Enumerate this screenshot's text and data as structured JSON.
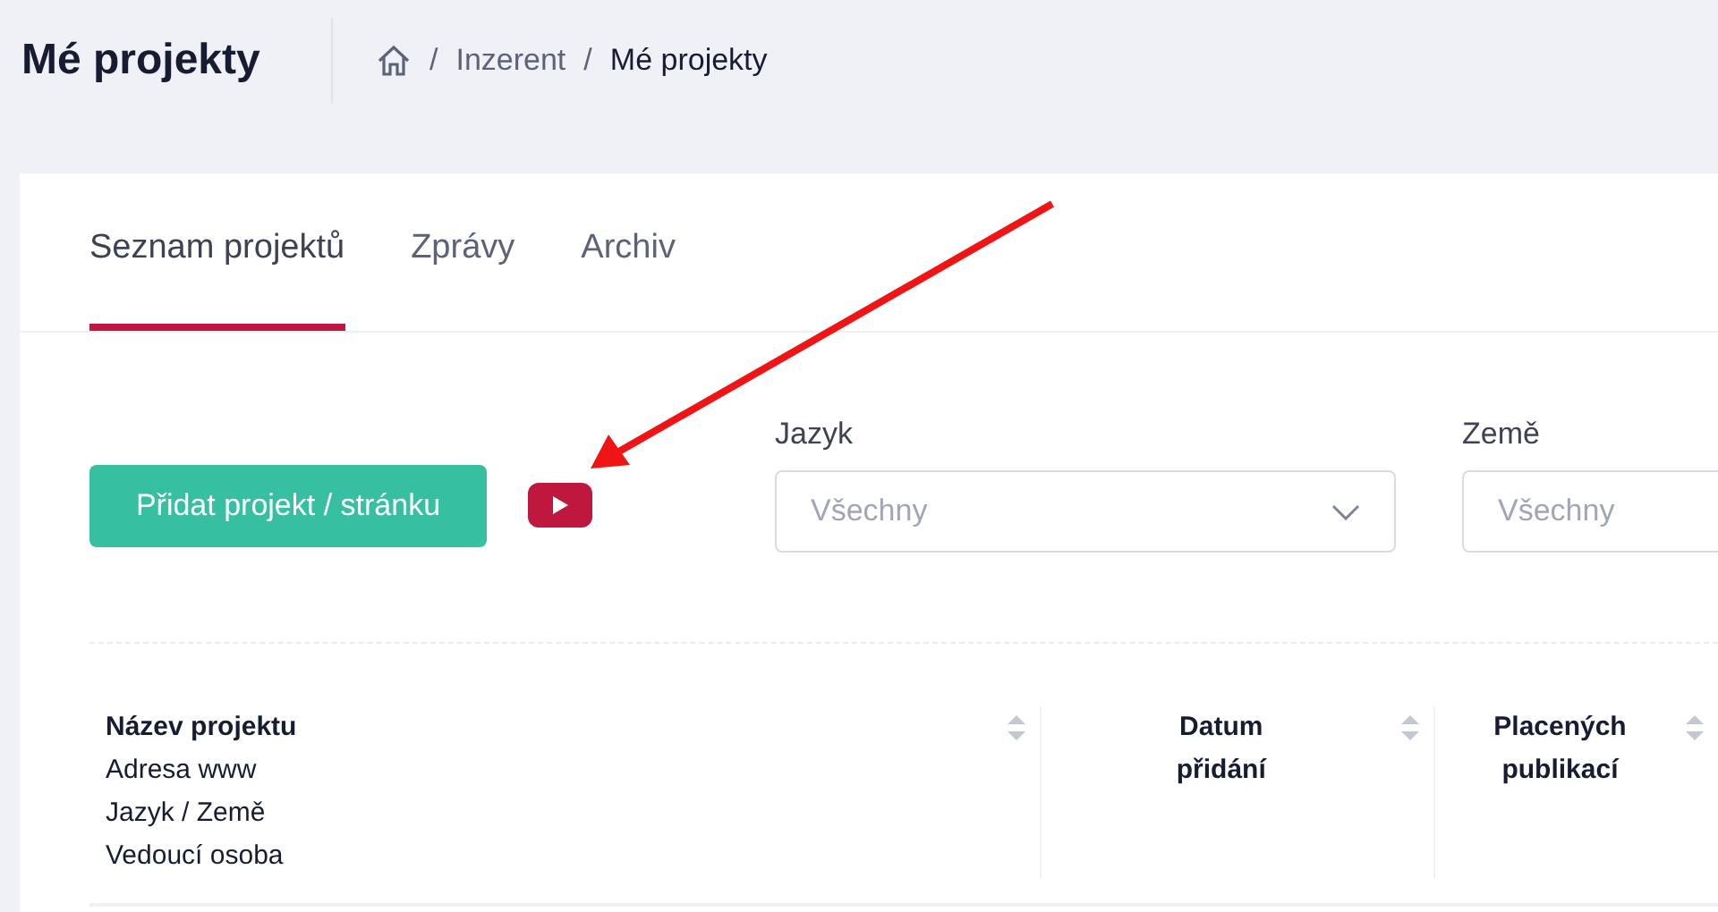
{
  "page_title": "Mé projekty",
  "breadcrumb": [
    {
      "kind": "separator",
      "text": "/"
    },
    {
      "kind": "link",
      "text": "Inzerent"
    },
    {
      "kind": "separator",
      "text": "/"
    },
    {
      "kind": "current",
      "text": "Mé projekty"
    }
  ],
  "tabs": [
    {
      "label": "Seznam projektů",
      "selected": true
    },
    {
      "label": "Zprávy",
      "selected": false
    },
    {
      "label": "Archiv",
      "selected": false
    }
  ],
  "add_button": "Přidat projekt / stránku",
  "filters": [
    {
      "label": "Jazyk",
      "placeholder": "Všechny",
      "caret": true
    },
    {
      "label": "Země",
      "placeholder": "Všechny"
    }
  ],
  "table": {
    "columns": [
      {
        "lines": [
          "Název projektu",
          "Adresa www",
          "Jazyk / Země",
          "Vedoucí osoba"
        ]
      },
      {
        "label": "Datum přidání"
      },
      {
        "label": "Placených publikací"
      }
    ]
  }
}
